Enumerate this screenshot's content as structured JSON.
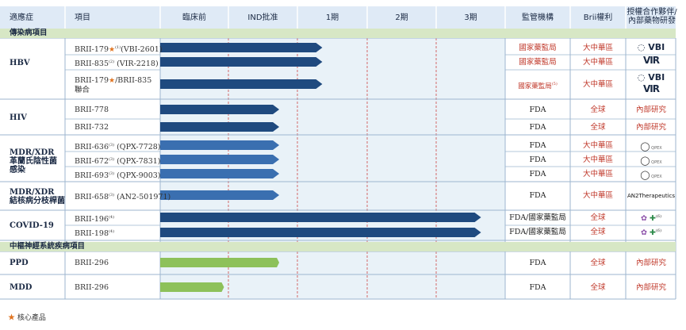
{
  "headers": {
    "indication": "適應症",
    "project": "項目",
    "preclinical": "臨床前",
    "ind": "IND批准",
    "phase1": "1期",
    "phase2": "2期",
    "phase3": "3期",
    "regulator": "監管機構",
    "rights": "Brii權利",
    "partner_line1": "授權合作夥伴/",
    "partner_line2": "內部藥物研發"
  },
  "sections": {
    "infectious": "傳染病項目",
    "cns": "中樞神經系統疾病項目"
  },
  "indications": {
    "hbv": "HBV",
    "hiv": "HIV",
    "mdr_line1": "MDR/XDR",
    "mdr_line2": "革蘭氏陰性菌",
    "mdr_line3": "感染",
    "mdrtb_line1": "MDR/XDR",
    "mdrtb_line2": "結核病分枝桿菌",
    "covid": "COVID-19",
    "ppd": "PPD",
    "mdd": "MDD"
  },
  "rows": [
    {
      "project": "BRII-179",
      "star": "★",
      "sup": "(1)",
      "suffix": "(VBI-2601)",
      "regulator": "國家藥監局",
      "rights": "大中華區",
      "partner": "VBI",
      "progress": 0.47
    },
    {
      "project": "BRII-835",
      "star": "",
      "sup": "(2)",
      "suffix": " (VIR-2218)",
      "regulator": "國家藥監局",
      "rights": "大中華區",
      "partner": "VIR",
      "progress": 0.47
    },
    {
      "project": "BRII-179",
      "star": "★",
      "sup": "",
      "suffix": "/BRII-835",
      "line2": "聯合",
      "regulator": "國家藥監局",
      "reg_sup": "(5)",
      "rights": "大中華區",
      "partner": "VBI",
      "partner2": "VIR",
      "progress": 0.47
    },
    {
      "project": "BRII-778",
      "star": "",
      "sup": "",
      "suffix": "",
      "regulator": "FDA",
      "rights": "全球",
      "partner": "內部研究",
      "progress": 0.345
    },
    {
      "project": "BRII-732",
      "star": "",
      "sup": "",
      "suffix": "",
      "regulator": "FDA",
      "rights": "全球",
      "partner": "內部研究",
      "progress": 0.345
    },
    {
      "project": "BRII-636",
      "star": "",
      "sup": "(3)",
      "suffix": " (QPX-7728)",
      "regulator": "FDA",
      "rights": "大中華區",
      "partner": "QPEX",
      "progress": 0.345
    },
    {
      "project": "BRII-672",
      "star": "",
      "sup": "(3)",
      "suffix": " (QPX-7831)",
      "regulator": "FDA",
      "rights": "大中華區",
      "partner": "QPEX",
      "progress": 0.345
    },
    {
      "project": "BRII-693",
      "star": "",
      "sup": "(3)",
      "suffix": " (QPX-9003)",
      "regulator": "FDA",
      "rights": "大中華區",
      "partner": "QPEX",
      "progress": 0.345
    },
    {
      "project": "BRII-658",
      "star": "",
      "sup": "(3)",
      "suffix": " (AN2-501971)",
      "regulator": "FDA",
      "rights": "大中華區",
      "partner": "AN2Therapeutics",
      "progress": 0.345
    },
    {
      "project": "BRII-196",
      "star": "",
      "sup": "(4)",
      "suffix": "",
      "regulator": "FDA/國家藥監局",
      "rights": "全球",
      "partner_sup": "(6)",
      "progress": 0.93
    },
    {
      "project": "BRII-198",
      "star": "",
      "sup": "(4)",
      "suffix": "",
      "regulator": "FDA/國家藥監局",
      "rights": "全球",
      "partner_sup": "(6)",
      "progress": 0.93
    },
    {
      "project": "BRII-296",
      "star": "",
      "sup": "",
      "suffix": "",
      "regulator": "FDA",
      "rights": "全球",
      "partner": "內部研究",
      "progress": 0.345
    },
    {
      "project": "BRII-296",
      "star": "",
      "sup": "",
      "suffix": "",
      "regulator": "FDA",
      "rights": "全球",
      "partner": "內部研究",
      "progress": 0.185
    }
  ],
  "legend": {
    "star": "★",
    "label": "核心產品"
  },
  "colors": {
    "header_bg": "#dfeaf6",
    "stage_bg": "#e9f2f8",
    "section_bg": "#d7e7c5",
    "bar_dark": "#1f4a7f",
    "bar_mid": "#3a6fb0",
    "bar_green": "#8dc15a",
    "dashed": "#d05a5a",
    "border": "#9db6cf"
  }
}
